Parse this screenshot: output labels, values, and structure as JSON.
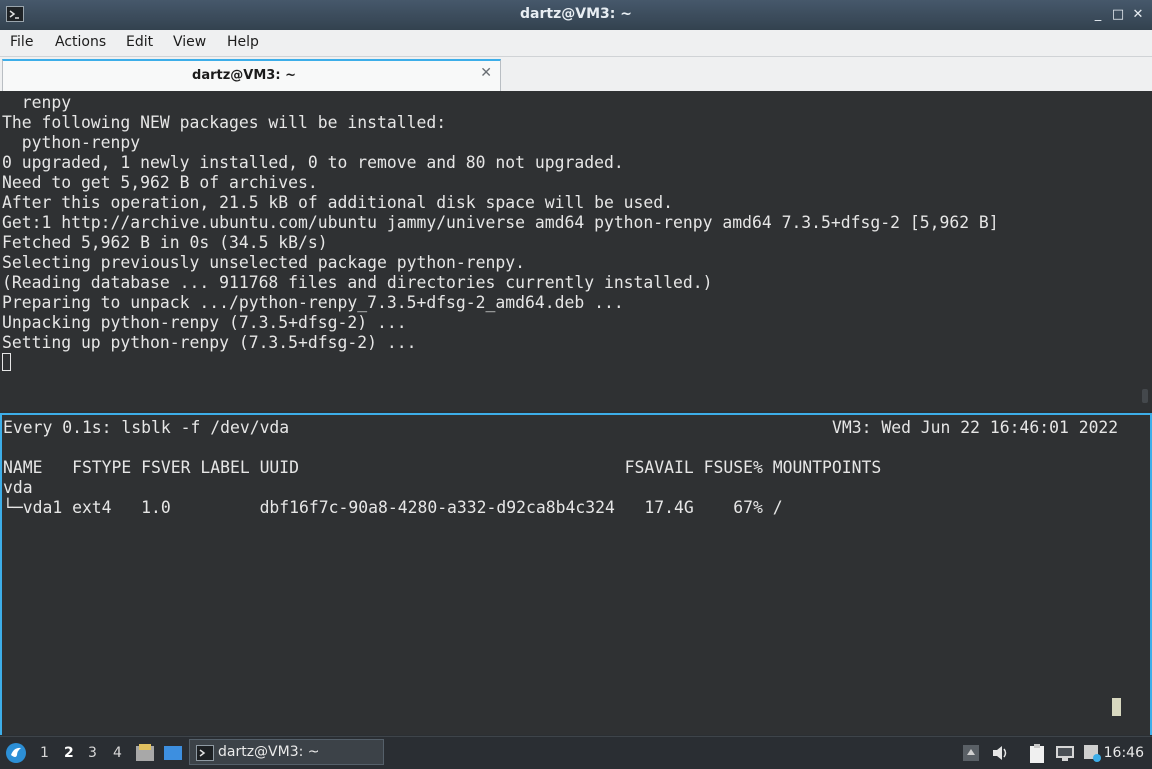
{
  "window": {
    "title": "dartz@VM3: ~",
    "buttons": {
      "minimize": "_",
      "maximize": "□",
      "close": "✕"
    }
  },
  "menu": [
    "File",
    "Actions",
    "Edit",
    "View",
    "Help"
  ],
  "tab": {
    "label": "dartz@VM3: ~",
    "close": "✕"
  },
  "terminal_top": {
    "lines": [
      "  renpy",
      "The following NEW packages will be installed:",
      "  python-renpy",
      "0 upgraded, 1 newly installed, 0 to remove and 80 not upgraded.",
      "Need to get 5,962 B of archives.",
      "After this operation, 21.5 kB of additional disk space will be used.",
      "Get:1 http://archive.ubuntu.com/ubuntu jammy/universe amd64 python-renpy amd64 7.3.5+dfsg-2 [5,962 B]",
      "Fetched 5,962 B in 0s (34.5 kB/s)",
      "Selecting previously unselected package python-renpy.",
      "(Reading database ... 911768 files and directories currently installed.)",
      "Preparing to unpack .../python-renpy_7.3.5+dfsg-2_amd64.deb ...",
      "Unpacking python-renpy (7.3.5+dfsg-2) ...",
      "Setting up python-renpy (7.3.5+dfsg-2) ..."
    ]
  },
  "terminal_bottom": {
    "header_left": "Every 0.1s: lsblk -f /dev/vda",
    "header_right": "VM3: Wed Jun 22 16:46:01 2022",
    "lines": [
      "NAME   FSTYPE FSVER LABEL UUID                                 FSAVAIL FSUSE% MOUNTPOINTS",
      "vda",
      "└─vda1 ext4   1.0         dbf16f7c-90a8-4280-a332-d92ca8b4c324   17.4G    67% /"
    ]
  },
  "taskbar": {
    "workspaces": [
      "1",
      "2",
      "3",
      "4"
    ],
    "active_workspace": "2",
    "task_label": "dartz@VM3: ~",
    "clock": "16:46"
  }
}
